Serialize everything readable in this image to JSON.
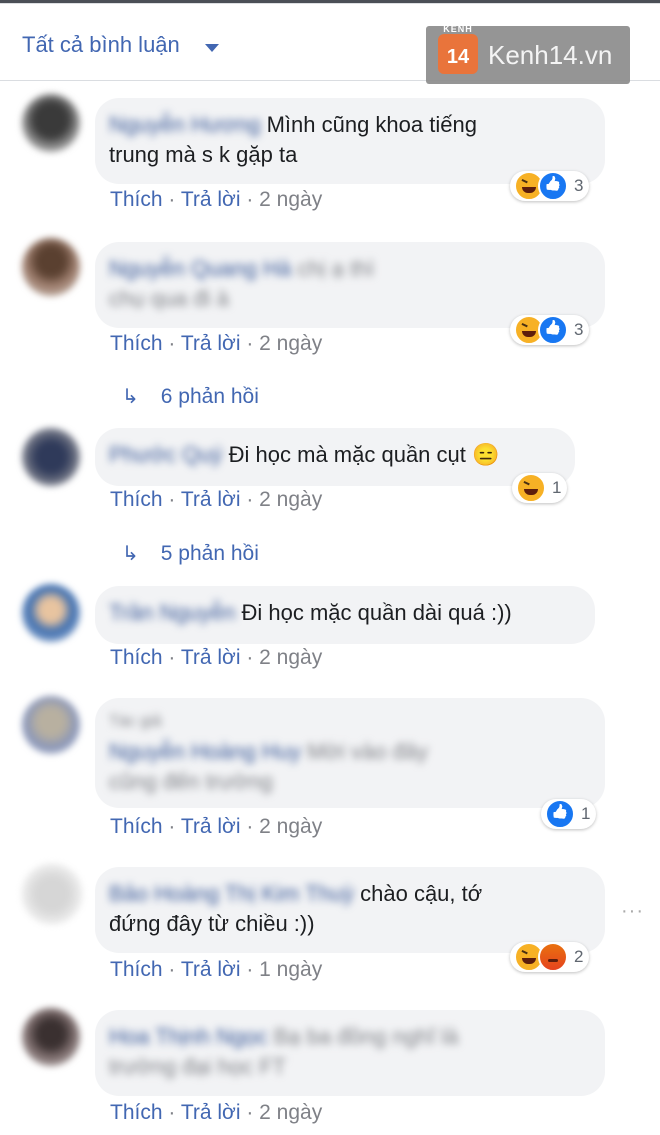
{
  "header": {
    "sort_label": "Tất cả bình luận",
    "watermark_text": "Kenh14.vn",
    "watermark_logo": "14",
    "watermark_logo_small": "KÊNH"
  },
  "labels": {
    "like": "Thích",
    "reply": "Trả lời",
    "sep": " · "
  },
  "comments": [
    {
      "author": "Nguyễn Hương",
      "text_line1": "Mình cũng khoa tiếng",
      "text_line2": "trung mà s k gặp ta",
      "time": "2 ngày",
      "reactions": [
        "haha",
        "like"
      ],
      "reaction_count": "3"
    },
    {
      "author": "Nguyễn Quang Hà",
      "text_line1": "chị ạ thì",
      "text_line2": "chụ qua đi à",
      "time": "2 ngày",
      "reactions": [
        "haha",
        "like"
      ],
      "reaction_count": "3",
      "replies": "6 phản hồi"
    },
    {
      "author": "Phước Quý",
      "text": "Đi học mà mặc quần cụt 😑",
      "time": "2 ngày",
      "reactions": [
        "haha"
      ],
      "reaction_count": "1",
      "replies": "5 phản hồi"
    },
    {
      "author": "Trần Nguyễn",
      "text": "Đi học mặc quần dài quá :))",
      "time": "2 ngày"
    },
    {
      "header_blurred": "Tác giả",
      "author": "Nguyễn Hoàng Huy",
      "text_line1": "Mời vào đây",
      "text_line2": "cũng đến trường",
      "time": "2 ngày",
      "reactions": [
        "like"
      ],
      "reaction_count": "1"
    },
    {
      "author": "Bảo Hoàng Thị Kim Thuỳ",
      "text_line1": "chào cậu, tớ",
      "text_line2": "đứng đây từ chiều :))",
      "time": "1 ngày",
      "reactions": [
        "haha",
        "angry"
      ],
      "reaction_count": "2"
    },
    {
      "author": "Hoa Thịnh Ngọc",
      "text_line1": "Bạ ba đồng nghĩ là",
      "text_line2": "trường đại học FT",
      "time": "2 ngày"
    }
  ],
  "icons": {
    "sort": "caret-down-icon",
    "reply_arrow": "reply-arrow-icon",
    "more": "more-options-icon",
    "reaction_types": [
      "haha-icon",
      "like-icon",
      "angry-icon"
    ]
  },
  "colors": {
    "link": "#4267b2",
    "bubble": "#f2f3f5",
    "muted": "#7f8187"
  }
}
